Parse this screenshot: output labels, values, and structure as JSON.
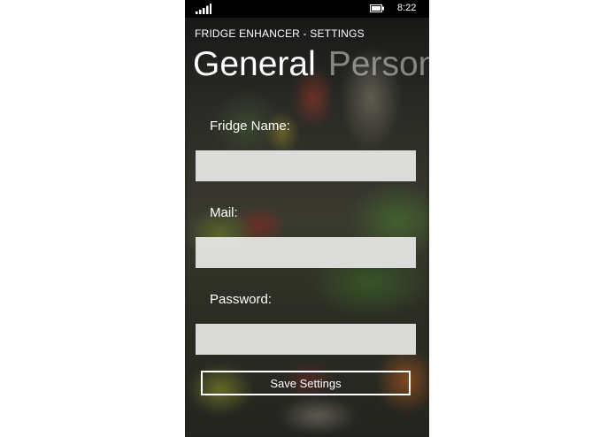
{
  "status_bar": {
    "time": "8:22",
    "icons": [
      "signal-strength-icon",
      "battery-icon"
    ]
  },
  "app": {
    "title": "FRIDGE ENHANCER - SETTINGS"
  },
  "pivot": {
    "items": [
      {
        "label": "General",
        "active": true
      },
      {
        "label": "Person",
        "active": false
      }
    ]
  },
  "form": {
    "fridge_name": {
      "label": "Fridge Name:",
      "value": ""
    },
    "mail": {
      "label": "Mail:",
      "value": ""
    },
    "password": {
      "label": "Password:",
      "value": ""
    },
    "save_label": "Save Settings"
  },
  "colors": {
    "status_bar": "#000000",
    "text": "#ffffff",
    "field": "#f2f2f2",
    "pivot_inactive": "rgba(255,255,255,0.45)"
  }
}
